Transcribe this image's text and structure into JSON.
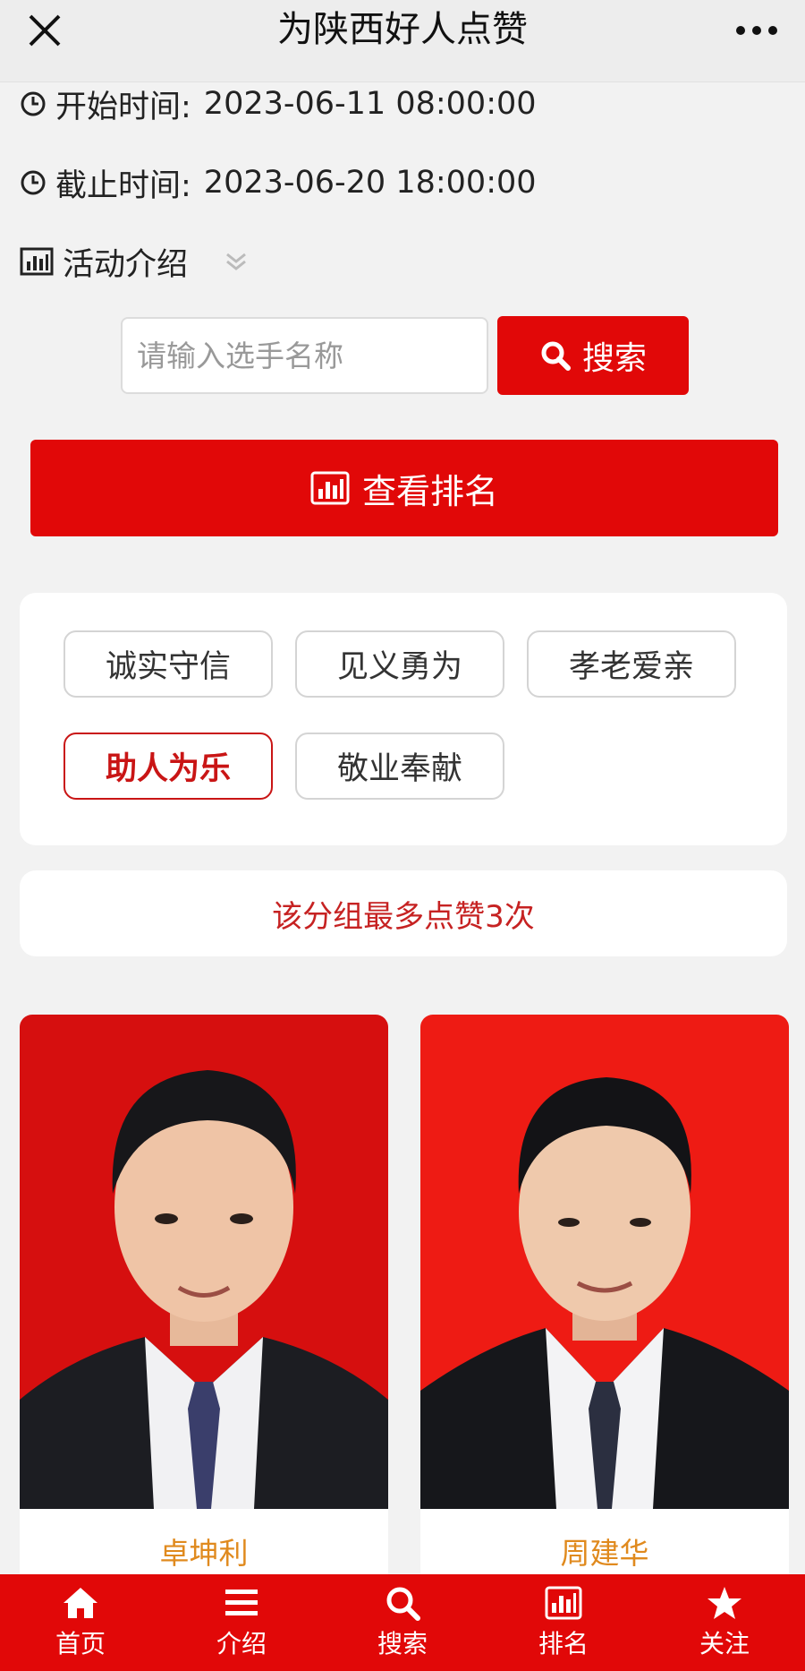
{
  "header": {
    "title": "为陕西好人点赞",
    "close_icon": "close-icon",
    "more_icon": "more-icon"
  },
  "info": {
    "start_label": "开始时间:",
    "start_value": "2023-06-11 08:00:00",
    "end_label": "截止时间:",
    "end_value": "2023-06-20 18:00:00",
    "intro_label": "活动介绍"
  },
  "search": {
    "placeholder": "请输入选手名称",
    "value": "",
    "button_label": "搜索"
  },
  "ranking_button": "查看排名",
  "categories": {
    "items": [
      "诚实守信",
      "见义勇为",
      "孝老爱亲",
      "助人为乐",
      "敬业奉献"
    ],
    "selected": "助人为乐"
  },
  "notice": "该分组最多点赞3次",
  "candidates": [
    {
      "name": "卓坤利"
    },
    {
      "name": "周建华"
    }
  ],
  "tabbar": {
    "items": [
      {
        "label": "首页",
        "icon": "home-icon"
      },
      {
        "label": "介绍",
        "icon": "menu-icon"
      },
      {
        "label": "搜索",
        "icon": "search-icon"
      },
      {
        "label": "排名",
        "icon": "chart-icon"
      },
      {
        "label": "关注",
        "icon": "star-icon"
      }
    ]
  },
  "colors": {
    "accent": "#e10808",
    "selected_tag": "#c91515",
    "notice_text": "#c62222",
    "candidate_name": "#e08a1e",
    "background": "#f2f2f2"
  }
}
